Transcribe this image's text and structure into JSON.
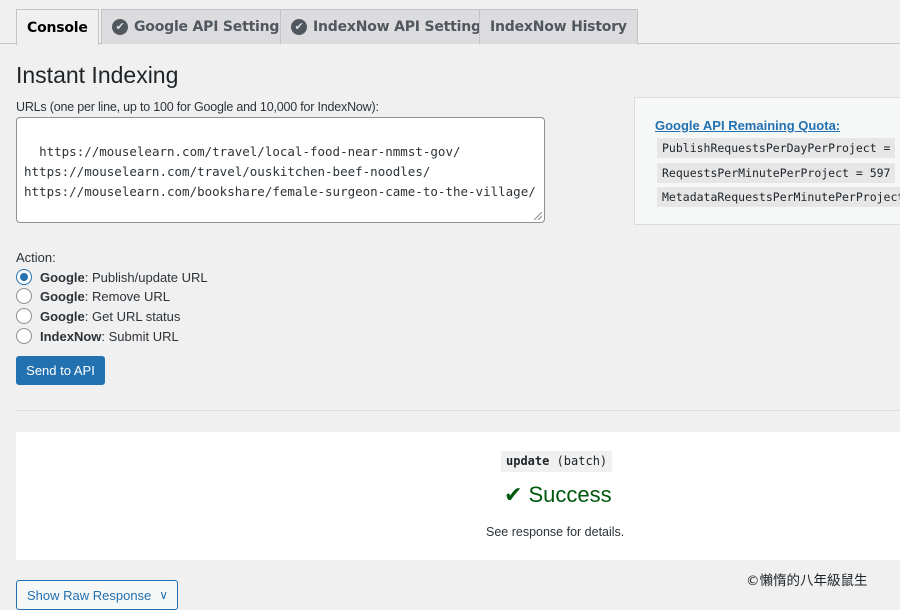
{
  "tabs": [
    {
      "label": "Console",
      "active": true,
      "icon": ""
    },
    {
      "label": "Google API Settings",
      "active": false,
      "icon": "check-circle-icon"
    },
    {
      "label": "IndexNow API Settings",
      "active": false,
      "icon": "check-circle-icon"
    },
    {
      "label": "IndexNow History",
      "active": false,
      "icon": ""
    }
  ],
  "page_title": "Instant Indexing",
  "urls": {
    "label": "URLs (one per line, up to 100 for Google and 10,000 for IndexNow):",
    "value": "https://mouselearn.com/travel/local-food-near-nmmst-gov/\nhttps://mouselearn.com/travel/ouskitchen-beef-noodles/\nhttps://mouselearn.com/bookshare/female-surgeon-came-to-the-village/"
  },
  "quota": {
    "title": "Google API Remaining Quota:",
    "items": [
      "PublishRequestsPerDayPerProject = ",
      "RequestsPerMinutePerProject = 597",
      "MetadataRequestsPerMinutePerProject"
    ]
  },
  "action": {
    "label": "Action:",
    "options": [
      {
        "service": "Google",
        "text": ": Publish/update URL",
        "checked": true
      },
      {
        "service": "Google",
        "text": ": Remove URL",
        "checked": false
      },
      {
        "service": "Google",
        "text": ": Get URL status",
        "checked": false
      },
      {
        "service": "IndexNow",
        "text": ": Submit URL",
        "checked": false
      }
    ]
  },
  "send_button": "Send to API",
  "result": {
    "code": "update",
    "code_suffix": " (batch)",
    "status": "Success",
    "note": "See response for details."
  },
  "raw_button": "Show Raw Response",
  "watermark": "©懶惰的八年級鼠生",
  "colors": {
    "accent": "#2271b1",
    "success": "#00580c",
    "background": "#f0f0f1"
  }
}
